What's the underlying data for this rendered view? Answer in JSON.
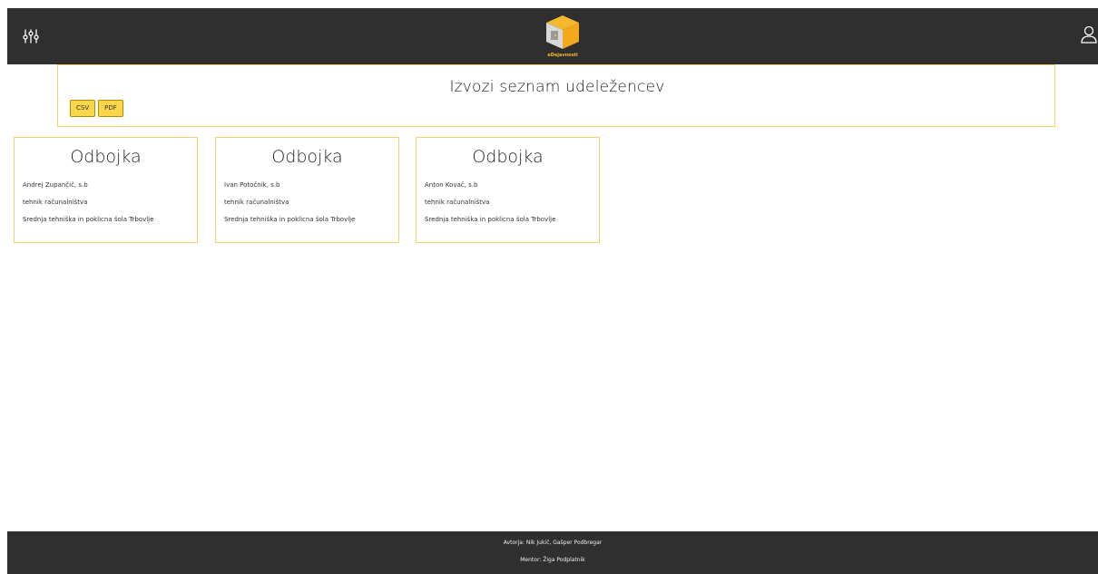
{
  "header": {
    "logo_text": "eDejavnosti",
    "filter_icon": "sliders-icon",
    "user_icon": "user-icon",
    "bg_color": "#2f2f2f"
  },
  "export": {
    "title": "Izvozi seznam udeležencev",
    "csv_label": "CSV",
    "pdf_label": "PDF",
    "button_color": "#fbd54a",
    "border_color": "#f3d36b"
  },
  "cards": [
    {
      "title": "Odbojka",
      "name": "Andrej Zupančič, s.b",
      "program": "tehnik računalništva",
      "school": "Srednja tehniška in poklicna šola Trbovlje"
    },
    {
      "title": "Odbojka",
      "name": "Ivan Potočnik, s.b",
      "program": "tehnik računalništva",
      "school": "Srednja tehniška in poklicna šola Trbovlje"
    },
    {
      "title": "Odbojka",
      "name": "Anton Kovač, s.b",
      "program": "tehnik računalništva",
      "school": "Srednja tehniška in poklicna šola Trbovlje"
    }
  ],
  "footer": {
    "authors": "Avtorja: Nik Jukič, Gašper Podbregar",
    "mentor": "Mentor: Žiga Podplatnik"
  }
}
